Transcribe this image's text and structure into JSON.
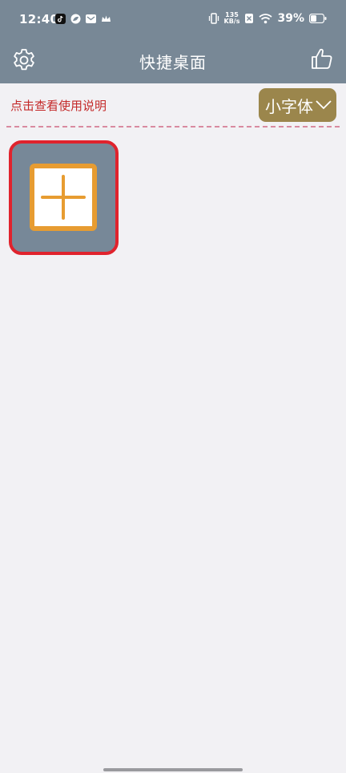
{
  "status_bar": {
    "time": "12:40",
    "net_speed_value": "135",
    "net_speed_unit": "KB/s",
    "battery_percent": "39%"
  },
  "header": {
    "title": "快捷桌面",
    "settings_icon": "gear-icon",
    "like_icon": "thumbs-up-icon"
  },
  "toolbar": {
    "help_link": "点击查看使用说明",
    "font_size_selected": "小字体"
  },
  "tiles": {
    "add_icon": "plus-icon"
  },
  "colors": {
    "header_bg": "#788896",
    "page_bg": "#f2f1f4",
    "help_text": "#c42a2a",
    "dropdown_bg": "#9b864c",
    "tile_bg": "#778898",
    "tile_highlight_border": "#e0232d",
    "add_icon_orange": "#e79c31"
  }
}
